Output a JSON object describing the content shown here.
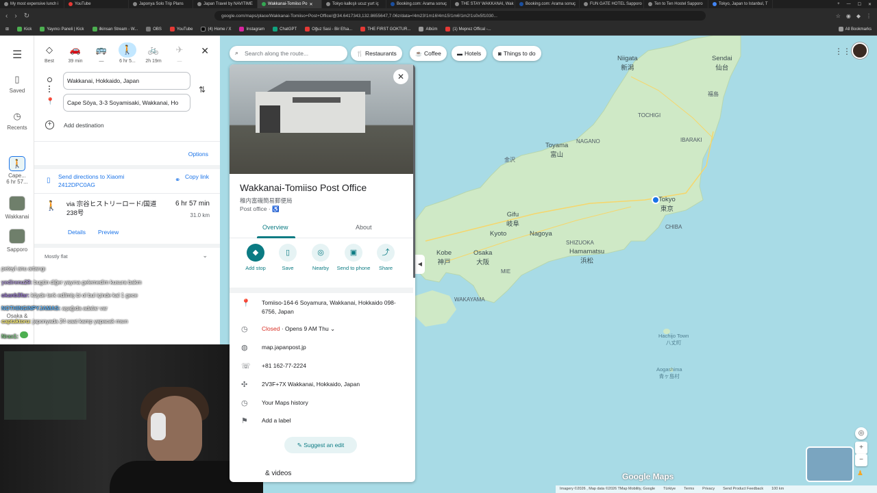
{
  "browser": {
    "tabs": [
      {
        "title": "My most expensive lunch i",
        "active": false
      },
      {
        "title": "YouTube",
        "active": false
      },
      {
        "title": "Japonya Solo Trip Plans",
        "active": false
      },
      {
        "title": "Japan Travel by NAVITIME",
        "active": false
      },
      {
        "title": "Wakkanai-Tomiiso Po",
        "active": true
      },
      {
        "title": "Tokyo kalkışlı ucuz yurt iç",
        "active": false
      },
      {
        "title": "Booking.com: Arama sonuç",
        "active": false
      },
      {
        "title": "THE STAY WAKKANAI, Wak",
        "active": false
      },
      {
        "title": "Booking.com: Arama sonuç",
        "active": false
      },
      {
        "title": "FUN GATE HOTEL Sapporo",
        "active": false
      },
      {
        "title": "Ten to Ten Hostel Sapporo",
        "active": false
      },
      {
        "title": "Tokyo, Japan to Istanbul, T",
        "active": false
      }
    ],
    "url": "google.com/maps/place/Wakkanai-Tomiiso+Post+Office/@34.6417343,132.8655647,7.06z/data=!4m23!1m16!4m15!1m6!1m2!1s0x5f1030...",
    "bookmarks": [
      "Kick",
      "Yayıncı Paneli | Kick",
      "ilkinsan Stream - W...",
      "OBS",
      "YouTube",
      "(4) Home / X",
      "Instagram",
      "ChatGPT",
      "Oğuz Sasi - Bir Efsa...",
      "THE FIRST GOKTUR...",
      "Albüm",
      "(1) Meprez Offical -..."
    ],
    "all_bookmarks": "All Bookmarks"
  },
  "rail": {
    "saved": "Saved",
    "recents": "Recents",
    "items": [
      {
        "label": "Cape...",
        "sub": "6 hr 57..."
      },
      {
        "label": "Wakkanai"
      },
      {
        "label": "Sapporo"
      },
      {
        "label": "Osaka &"
      }
    ]
  },
  "directions": {
    "modes": [
      {
        "icon": "diamond-icon",
        "label": "Best"
      },
      {
        "icon": "car-icon",
        "label": "39 min"
      },
      {
        "icon": "bus-icon",
        "label": "—"
      },
      {
        "icon": "walk-icon",
        "label": "6 hr 5..."
      },
      {
        "icon": "bike-icon",
        "label": "2h 19m"
      },
      {
        "icon": "plane-icon",
        "label": "—"
      }
    ],
    "origin": "Wakkanai, Hokkaido, Japan",
    "destination": "Cape Sōya, 3-3 Soyamisaki, Wakkanai, Ho",
    "add_destination": "Add destination",
    "options": "Options",
    "send_directions": "Send directions to Xiaomi 2412DPC0AG",
    "copy_link": "Copy link",
    "route": {
      "via": "via 宗谷ヒストリーロード/国道238号",
      "time": "6 hr 57 min",
      "distance": "31.0 km",
      "details": "Details",
      "preview": "Preview"
    },
    "terrain": "Mostly flat"
  },
  "chat": [
    {
      "name": "",
      "text": "peteyl anu artarıgı"
    },
    {
      "name": "yedirenu29:",
      "text": "bugün diğer yayına gelemedim kusura bakm"
    },
    {
      "name": "okanb3far:",
      "text": "köyde terk edilmiş bi ol bul içinde kal 1 gece"
    },
    {
      "name": "NOTHINGINPYJAMAS:",
      "text": "aşağıda adalar var"
    },
    {
      "name": "captaktoru:",
      "text": "japonyada 24 saat kamp yapacak msın"
    },
    {
      "name": "Nrax1:",
      "text": ""
    }
  ],
  "place": {
    "title": "Wakkanai-Tomiiso Post Office",
    "japanese": "稚内富磯簡易郵便局",
    "type": "Post office · ♿",
    "tabs": [
      "Overview",
      "About"
    ],
    "actions": [
      {
        "icon": "pin-icon",
        "label": "Add stop"
      },
      {
        "icon": "bookmark-icon",
        "label": "Save"
      },
      {
        "icon": "nearby-icon",
        "label": "Nearby"
      },
      {
        "icon": "phone-icon",
        "label": "Send to phone"
      },
      {
        "icon": "share-icon",
        "label": "Share"
      }
    ],
    "address": "Tomiiso-164-6 Soyamura, Wakkanai, Hokkaido 098-6756, Japan",
    "hours_status": "Closed",
    "hours_next": "· Opens 9 AM Thu",
    "website": "map.japanpost.jp",
    "phone": "+81 162-77-2224",
    "plus_code": "2V3F+7X Wakkanai, Hokkaido, Japan",
    "history": "Your Maps history",
    "label": "Add a label",
    "suggest_edit": "Suggest an edit",
    "photos_videos": "& videos"
  },
  "map": {
    "search_placeholder": "Search along the route...",
    "chips": [
      "Restaurants",
      "Coffee",
      "Hotels",
      "Things to do"
    ],
    "labels": {
      "niigata": "Niigata",
      "niigata_jp": "新潟",
      "sendai": "Sendai",
      "sendai_jp": "仙台",
      "fukushima": "福島",
      "toyama": "Toyama",
      "toyama_jp": "富山",
      "kanazawa": "金沢",
      "tokyo": "Tokyo",
      "tokyo_jp": "東京",
      "chiba": "CHIBA",
      "gifu": "Gifu",
      "gifu_jp": "岐阜",
      "kyoto": "Kyoto",
      "nagoya": "Nagoya",
      "kobe": "Kobe",
      "kobe_jp": "神戸",
      "osaka": "Osaka",
      "osaka_jp": "大阪",
      "shizuoka": "SHIZUOKA",
      "hamamatsu": "Hamamatsu",
      "hamamatsu_jp": "浜松",
      "mie": "MIE",
      "wakayama": "WAKAYAMA",
      "hachijo": "Hachijo Town",
      "hachijo_jp": "八丈町",
      "aogashima": "Aogashima",
      "aogashima_jp": "青ヶ島村",
      "tochigi": "TOCHIGI",
      "ibaraki": "IBARAKI",
      "nagano": "NAGANO"
    },
    "logo": "Google Maps",
    "attribution": [
      "Imagery ©2026 , Map data ©2026 TMap Mobility, Google",
      "Türkiye",
      "Terms",
      "Privacy",
      "Send Product Feedback",
      "100 km"
    ]
  }
}
